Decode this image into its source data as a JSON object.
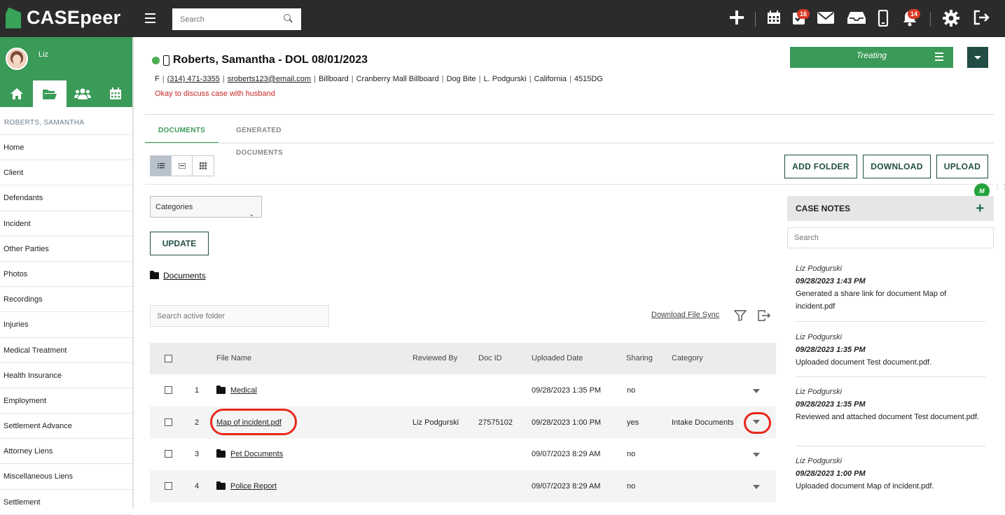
{
  "app": {
    "brand": "CASEpeer",
    "search_placeholder": "Search"
  },
  "topbar": {
    "icons": [
      "plus-icon",
      "calendar-icon",
      "tasks-icon",
      "mail-icon",
      "inbox-icon",
      "phone-icon",
      "bell-icon",
      "gear-icon",
      "logout-icon"
    ],
    "tasks_badge": "16",
    "bell_badge": "14"
  },
  "sidebar": {
    "user": "Liz",
    "case_name": "ROBERTS, SAMANTHA",
    "tabs": [
      "home-icon",
      "folder-icon",
      "people-icon",
      "calendar-icon"
    ],
    "items": [
      "Home",
      "Client",
      "Defendants",
      "Incident",
      "Other Parties",
      "Photos",
      "Recordings",
      "Injuries",
      "Medical Treatment",
      "Health Insurance",
      "Employment",
      "Settlement Advance",
      "Attorney Liens",
      "Miscellaneous Liens",
      "Settlement"
    ]
  },
  "case": {
    "title": "Roberts, Samantha - DOL 08/01/2023",
    "gender": "F",
    "phone": "(314) 471-3355",
    "email": "sroberts123@email.com",
    "meta": [
      "Billboard",
      "Cranberry Mall Billboard",
      "Dog Bite",
      "L. Podgurski",
      "California",
      "4515DG"
    ],
    "note": "Okay to discuss case with husband",
    "status": "Treating"
  },
  "tabs": {
    "documents": "DOCUMENTS",
    "generated": "GENERATED DOCUMENTS"
  },
  "actions": {
    "add_folder": "ADD FOLDER",
    "download": "DOWNLOAD",
    "upload": "UPLOAD"
  },
  "filters": {
    "categories": "Categories",
    "update": "UPDATE"
  },
  "breadcrumb": {
    "label": "Documents"
  },
  "folder_search": {
    "placeholder": "Search active folder"
  },
  "download_sync": "Download File Sync",
  "table": {
    "headers": {
      "file_name": "File Name",
      "reviewed_by": "Reviewed By",
      "doc_id": "Doc ID",
      "uploaded": "Uploaded Date",
      "sharing": "Sharing",
      "category": "Category"
    },
    "rows": [
      {
        "num": "1",
        "type": "folder",
        "name": "Medical",
        "reviewed_by": "",
        "doc_id": "",
        "uploaded": "09/28/2023 1:35 PM",
        "sharing": "no",
        "category": ""
      },
      {
        "num": "2",
        "type": "file",
        "name": "Map of incident.pdf",
        "reviewed_by": "Liz Podgurski",
        "doc_id": "27575102",
        "uploaded": "09/28/2023 1:00 PM",
        "sharing": "yes",
        "category": "Intake Documents"
      },
      {
        "num": "3",
        "type": "folder",
        "name": "Pet Documents",
        "reviewed_by": "",
        "doc_id": "",
        "uploaded": "09/07/2023 8:29 AM",
        "sharing": "no",
        "category": ""
      },
      {
        "num": "4",
        "type": "folder",
        "name": "Police Report",
        "reviewed_by": "",
        "doc_id": "",
        "uploaded": "09/07/2023 8:29 AM",
        "sharing": "no",
        "category": ""
      }
    ]
  },
  "case_notes": {
    "title": "CASE NOTES",
    "search_placeholder": "Search",
    "notes": [
      {
        "author": "Liz Podgurski",
        "date": "09/28/2023 1:43 PM",
        "text": "Generated a share link for document Map of incident.pdf"
      },
      {
        "author": "Liz Podgurski",
        "date": "09/28/2023 1:35 PM",
        "text": "Uploaded document Test document.pdf."
      },
      {
        "author": "Liz Podgurski",
        "date": "09/28/2023 1:35 PM",
        "text": "Reviewed and attached document Test document.pdf."
      },
      {
        "author": "Liz Podgurski",
        "date": "09/28/2023 1:00 PM",
        "text": "Uploaded document Map of incident.pdf."
      }
    ]
  },
  "widget": {
    "label": "M"
  },
  "colors": {
    "brand_green": "#3a9a57",
    "dark_green": "#1f4d43",
    "highlight_red": "#e8281b",
    "topbar": "#2b2b2b"
  }
}
